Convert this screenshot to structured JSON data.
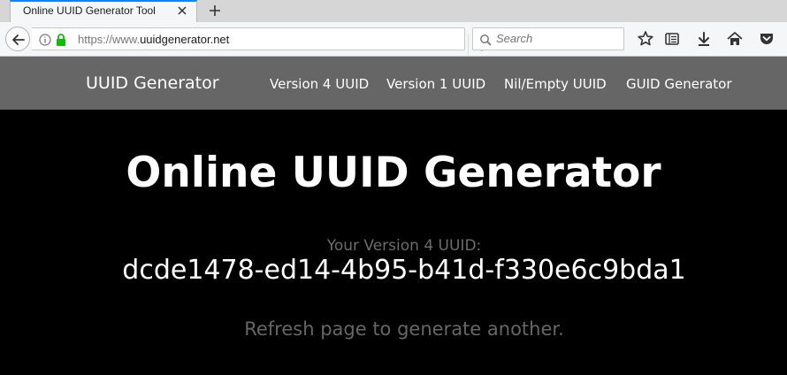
{
  "browser": {
    "tab": {
      "title": "Online UUID Generator Tool",
      "close_icon": "close-icon"
    },
    "new_tab_icon": "plus-icon",
    "url": {
      "scheme": "https://www.",
      "host": "uuidgenerator.net"
    },
    "search": {
      "placeholder": "Search"
    },
    "toolbar_icons": [
      "star-icon",
      "reader-list-icon",
      "download-icon",
      "home-icon",
      "pocket-icon"
    ],
    "accent_color": "#0a84ff"
  },
  "site": {
    "brand": "UUID Generator",
    "nav": [
      {
        "label": "Version 4 UUID"
      },
      {
        "label": "Version 1 UUID"
      },
      {
        "label": "Nil/Empty UUID"
      },
      {
        "label": "GUID Generator"
      }
    ],
    "header_color": "#666666"
  },
  "main": {
    "title": "Online UUID Generator",
    "uuid_label": "Your Version 4 UUID:",
    "uuid_value": "dcde1478-ed14-4b95-b41d-f330e6c9bda1",
    "refresh_note": "Refresh page to generate another."
  }
}
